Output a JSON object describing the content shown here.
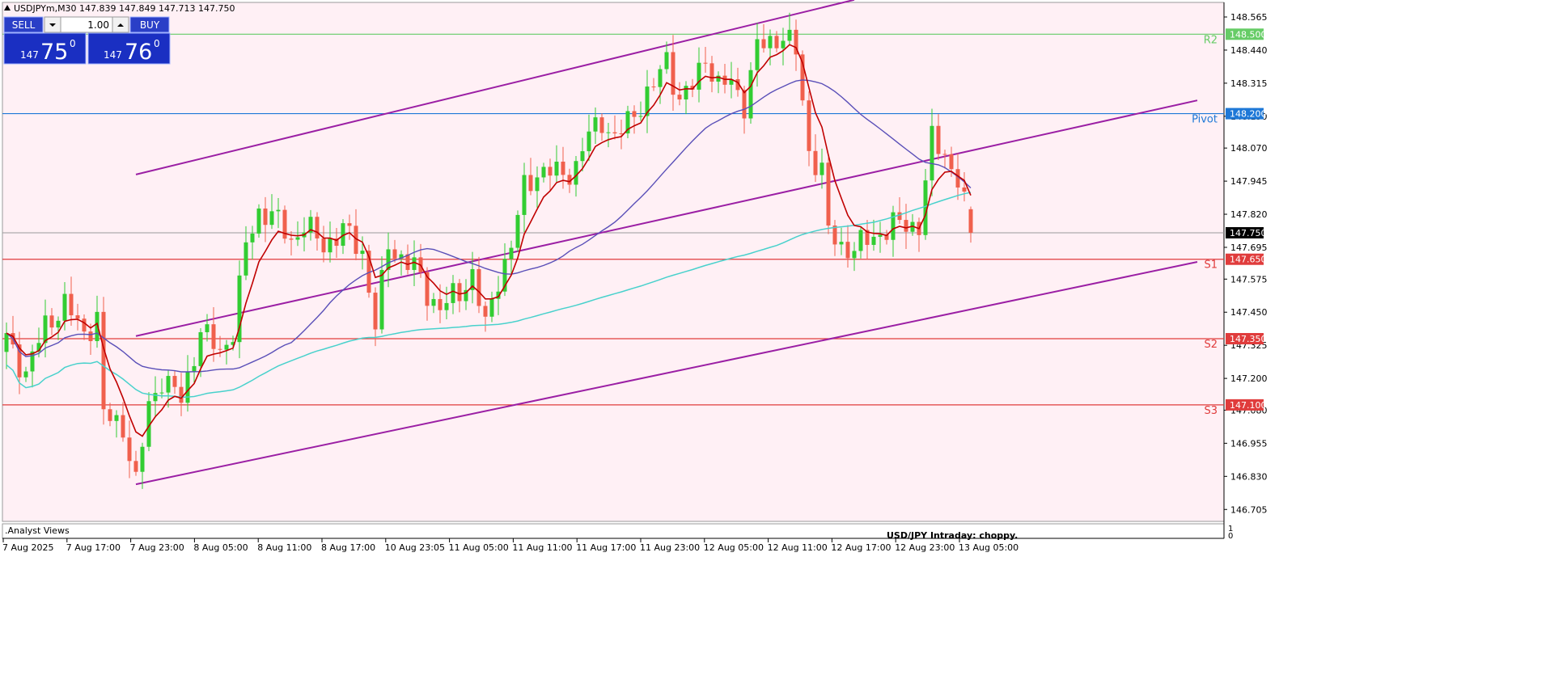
{
  "header": {
    "symbol_line": "USDJPYm,M30  147.839 147.849 147.713 147.750"
  },
  "trade_panel": {
    "sell_label": "SELL",
    "buy_label": "BUY",
    "lot_value": "1.00",
    "sell_price_small": "147",
    "sell_price_big": "75",
    "sell_price_sup": "0",
    "buy_price_small": "147",
    "buy_price_big": "76",
    "buy_price_sup": "0"
  },
  "indicator_panel": {
    "title": ".Analyst Views",
    "text": "USD/JPY Intraday:  choppy.",
    "scale_top": "1",
    "scale_bottom": "0"
  },
  "colors": {
    "background": "#fff0f5",
    "bull": "#32cd32",
    "bear": "#f0604d",
    "ema_fast": "#c00000",
    "sma_mid": "#5a4fb8",
    "sma_slow": "#48d1cc",
    "channel": "#9b1fa4",
    "resistance": "#66cc66",
    "pivot": "#1e78d7",
    "support": "#e03c3c",
    "current_price": "#000000"
  },
  "chart_data": {
    "type": "candlestick",
    "symbol": "USDJPYm",
    "timeframe": "M30",
    "ylim": [
      146.66,
      148.62
    ],
    "y_ticks": [
      "148.565",
      "148.440",
      "148.315",
      "148.190",
      "148.070",
      "147.945",
      "147.820",
      "147.695",
      "147.575",
      "147.450",
      "147.325",
      "147.200",
      "147.080",
      "146.955",
      "146.830",
      "146.705"
    ],
    "x_ticks": [
      "7 Aug 2025",
      "7 Aug 17:00",
      "7 Aug 23:00",
      "8 Aug 05:00",
      "8 Aug 11:00",
      "8 Aug 17:00",
      "10 Aug 23:05",
      "11 Aug 05:00",
      "11 Aug 11:00",
      "11 Aug 17:00",
      "11 Aug 23:00",
      "12 Aug 05:00",
      "12 Aug 11:00",
      "12 Aug 17:00",
      "12 Aug 23:00",
      "13 Aug 05:00"
    ],
    "candle_count": 150,
    "anchors": [
      [
        0,
        147.35
      ],
      [
        3,
        147.22
      ],
      [
        6,
        147.4
      ],
      [
        9,
        147.48
      ],
      [
        12,
        147.37
      ],
      [
        14,
        147.43
      ],
      [
        15,
        147.06
      ],
      [
        18,
        147.02
      ],
      [
        20,
        146.8
      ],
      [
        22,
        147.1
      ],
      [
        24,
        147.2
      ],
      [
        27,
        147.12
      ],
      [
        30,
        147.38
      ],
      [
        33,
        147.3
      ],
      [
        35,
        147.38
      ],
      [
        37,
        147.7
      ],
      [
        39,
        147.83
      ],
      [
        41,
        147.82
      ],
      [
        44,
        147.72
      ],
      [
        46,
        147.78
      ],
      [
        49,
        147.7
      ],
      [
        52,
        147.76
      ],
      [
        55,
        147.68
      ],
      [
        57,
        147.4
      ],
      [
        59,
        147.7
      ],
      [
        61,
        147.66
      ],
      [
        63,
        147.62
      ],
      [
        65,
        147.52
      ],
      [
        67,
        147.47
      ],
      [
        70,
        147.52
      ],
      [
        72,
        147.6
      ],
      [
        74,
        147.39
      ],
      [
        76,
        147.58
      ],
      [
        78,
        147.7
      ],
      [
        80,
        147.92
      ],
      [
        82,
        147.98
      ],
      [
        84,
        147.98
      ],
      [
        86,
        147.97
      ],
      [
        88,
        148.0
      ],
      [
        90,
        148.12
      ],
      [
        92,
        148.18
      ],
      [
        94,
        148.1
      ],
      [
        96,
        148.17
      ],
      [
        98,
        148.24
      ],
      [
        100,
        148.3
      ],
      [
        102,
        148.41
      ],
      [
        104,
        148.25
      ],
      [
        106,
        148.3
      ],
      [
        108,
        148.42
      ],
      [
        110,
        148.3
      ],
      [
        112,
        148.32
      ],
      [
        114,
        148.24
      ],
      [
        116,
        148.45
      ],
      [
        118,
        148.47
      ],
      [
        120,
        148.5
      ],
      [
        122,
        148.43
      ],
      [
        124,
        148.06
      ],
      [
        126,
        147.98
      ],
      [
        127,
        147.75
      ],
      [
        129,
        147.7
      ],
      [
        131,
        147.69
      ],
      [
        133,
        147.72
      ],
      [
        135,
        147.75
      ],
      [
        137,
        147.78
      ],
      [
        139,
        147.78
      ],
      [
        141,
        147.78
      ],
      [
        143,
        148.1
      ],
      [
        145,
        148.05
      ],
      [
        147,
        147.95
      ],
      [
        149,
        147.75
      ]
    ],
    "last": {
      "open": 147.839,
      "high": 147.849,
      "low": 147.713,
      "close": 147.75
    },
    "series": [
      {
        "name": "EMA (red)",
        "style": "line"
      },
      {
        "name": "MA (dark blue)",
        "style": "line"
      },
      {
        "name": "MA (turquoise)",
        "style": "line"
      }
    ],
    "levels": [
      {
        "name": "R2",
        "price": 148.5,
        "price_label": "148.500"
      },
      {
        "name": "Pivot",
        "price": 148.2,
        "price_label": "148.200"
      },
      {
        "name": "S1",
        "price": 147.65,
        "price_label": "147.650"
      },
      {
        "name": "S2",
        "price": 147.35,
        "price_label": "147.350"
      },
      {
        "name": "S3",
        "price": 147.1,
        "price_label": "147.100"
      }
    ],
    "current_price": {
      "price": 147.75,
      "label": "147.750"
    },
    "channel": {
      "upper": [
        [
          20,
          147.97
        ],
        [
          131,
          148.63
        ]
      ],
      "middle": [
        [
          20,
          147.36
        ],
        [
          184,
          148.25
        ]
      ],
      "lower": [
        [
          20,
          146.8
        ],
        [
          184,
          147.64
        ]
      ]
    },
    "grid": false
  }
}
